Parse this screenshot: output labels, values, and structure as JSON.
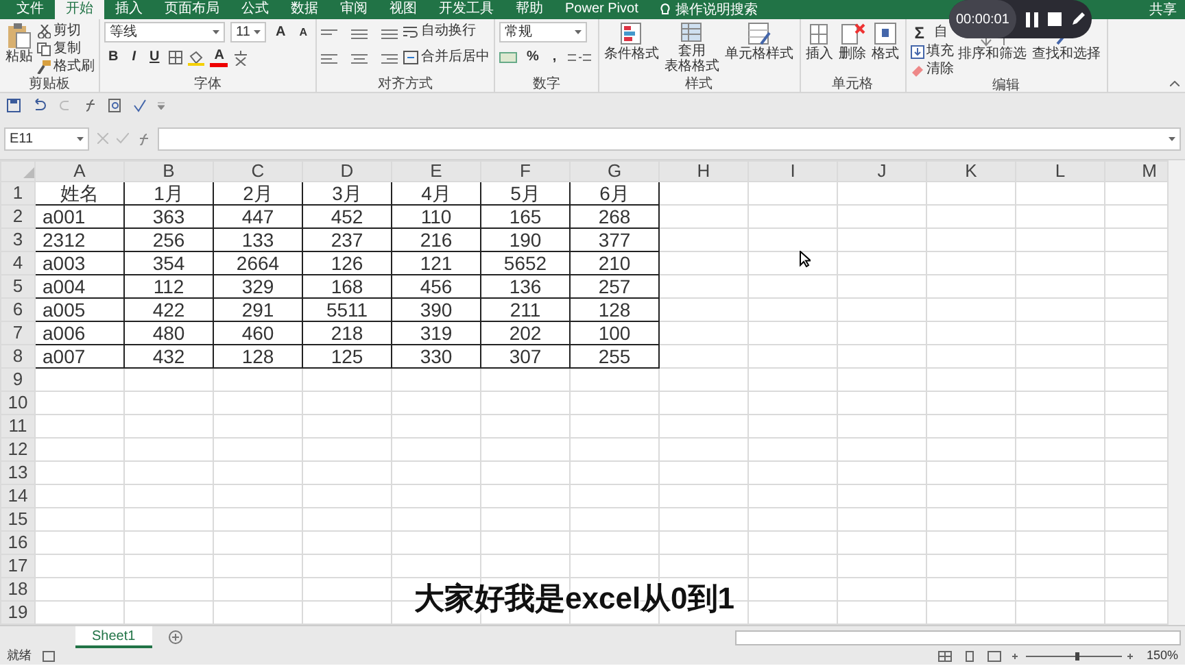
{
  "app_tabs": [
    {
      "label": "文件",
      "selected": false
    },
    {
      "label": "开始",
      "selected": true
    },
    {
      "label": "插入",
      "selected": false
    },
    {
      "label": "页面布局",
      "selected": false
    },
    {
      "label": "公式",
      "selected": false
    },
    {
      "label": "数据",
      "selected": false
    },
    {
      "label": "审阅",
      "selected": false
    },
    {
      "label": "视图",
      "selected": false
    },
    {
      "label": "开发工具",
      "selected": false
    },
    {
      "label": "帮助",
      "selected": false
    },
    {
      "label": "Power Pivot",
      "selected": false
    }
  ],
  "tell_me": "操作说明搜索",
  "share": "共享",
  "ribbon": {
    "clipboard": {
      "title": "剪贴板",
      "paste": "粘贴",
      "cut": "剪切",
      "copy": "复制",
      "format_painter": "格式刷"
    },
    "font": {
      "title": "字体",
      "name": "等线",
      "size": "11",
      "grow": "A",
      "shrink": "A",
      "bold": "B",
      "italic": "I",
      "underline": "U",
      "font_color": "A"
    },
    "alignment": {
      "title": "对齐方式",
      "wrap": "自动换行",
      "merge": "合并后居中"
    },
    "number": {
      "title": "数字",
      "format": "常规",
      "percent": "%",
      "comma": ","
    },
    "styles": {
      "title": "样式",
      "conditional": "条件格式",
      "table_line1": "套用",
      "table_line2": "表格格式",
      "cell_styles": "单元格样式"
    },
    "cells": {
      "title": "单元格",
      "insert": "插入",
      "delete": "删除",
      "format": "格式"
    },
    "editing": {
      "title": "编辑",
      "sigma": "Σ",
      "autosum": "自",
      "fill": "填充",
      "clear": "清除",
      "sort": "排序和筛选",
      "find": "查找和选择"
    }
  },
  "name_box": "E11",
  "columns": [
    "A",
    "B",
    "C",
    "D",
    "E",
    "F",
    "G",
    "H",
    "I",
    "J",
    "K",
    "L",
    "M"
  ],
  "rows": [
    {
      "header": "1",
      "cells": [
        "姓名",
        "1月",
        "2月",
        "3月",
        "4月",
        "5月",
        "6月"
      ]
    },
    {
      "header": "2",
      "cells": [
        "a001",
        "363",
        "447",
        "452",
        "110",
        "165",
        "268"
      ]
    },
    {
      "header": "3",
      "cells": [
        "2312",
        "256",
        "133",
        "237",
        "216",
        "190",
        "377"
      ]
    },
    {
      "header": "4",
      "cells": [
        "a003",
        "354",
        "2664",
        "126",
        "121",
        "5652",
        "210"
      ]
    },
    {
      "header": "5",
      "cells": [
        "a004",
        "112",
        "329",
        "168",
        "456",
        "136",
        "257"
      ]
    },
    {
      "header": "6",
      "cells": [
        "a005",
        "422",
        "291",
        "5511",
        "390",
        "211",
        "128"
      ]
    },
    {
      "header": "7",
      "cells": [
        "a006",
        "480",
        "460",
        "218",
        "319",
        "202",
        "100"
      ]
    },
    {
      "header": "8",
      "cells": [
        "a007",
        "432",
        "128",
        "125",
        "330",
        "307",
        "255"
      ]
    },
    {
      "header": "9",
      "cells": []
    },
    {
      "header": "10",
      "cells": []
    },
    {
      "header": "11",
      "cells": []
    },
    {
      "header": "12",
      "cells": []
    },
    {
      "header": "13",
      "cells": []
    },
    {
      "header": "14",
      "cells": []
    },
    {
      "header": "15",
      "cells": []
    },
    {
      "header": "16",
      "cells": []
    },
    {
      "header": "17",
      "cells": []
    },
    {
      "header": "18",
      "cells": []
    },
    {
      "header": "19",
      "cells": []
    }
  ],
  "sheet_tabs": [
    {
      "label": "Sheet1",
      "selected": true
    }
  ],
  "status": "就绪",
  "zoom": "150%",
  "recorder": {
    "time": "00:00:01"
  },
  "subtitle": "大家好我是excel从0到1"
}
